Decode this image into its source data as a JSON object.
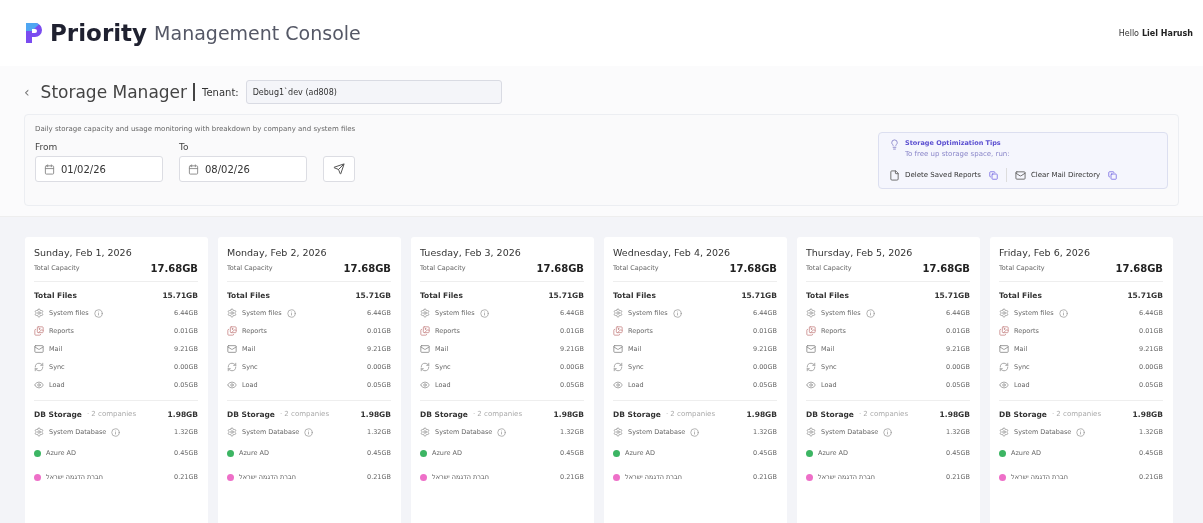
{
  "header": {
    "brand": "Priority",
    "app_title": "Management Console",
    "greeting": "Hello",
    "user": "Liel Harush"
  },
  "page": {
    "back": "‹",
    "title": "Storage Manager",
    "tenant_label": "Tenant:",
    "tenant_value": "Debug1`dev (ad808)"
  },
  "filters": {
    "description": "Daily storage capacity and usage monitoring with breakdown by company and system files",
    "from_label": "From",
    "from_value": "01/02/26",
    "to_label": "To",
    "to_value": "08/02/26"
  },
  "tips": {
    "title": "Storage Optimization Tips",
    "subtitle": "To free up storage space, run:",
    "actions": [
      {
        "kind": "reports",
        "label": "Delete Saved Reports"
      },
      {
        "kind": "mail",
        "label": "Clear Mail Directory"
      }
    ]
  },
  "days": [
    {
      "date": "Sunday, Feb 1, 2026",
      "capacity_label": "Total Capacity",
      "capacity": "17.68GB",
      "files_label": "Total Files",
      "files_total": "15.71GB",
      "files": [
        {
          "kind": "system",
          "label": "System files",
          "value": "6.44GB"
        },
        {
          "kind": "reports",
          "label": "Reports",
          "value": "0.01GB"
        },
        {
          "kind": "mail",
          "label": "Mail",
          "value": "9.21GB"
        },
        {
          "kind": "sync",
          "label": "Sync",
          "value": "0.00GB"
        },
        {
          "kind": "load",
          "label": "Load",
          "value": "0.05GB"
        }
      ],
      "db_label": "DB Storage",
      "db_note": "· 2 companies",
      "db_total": "1.98GB",
      "db": [
        {
          "kind": "system",
          "label": "System Database",
          "value": "1.32GB"
        },
        {
          "kind": "company",
          "color": "#3cb563",
          "label": "Azure AD",
          "value": "0.45GB"
        },
        {
          "kind": "company",
          "color": "#ee6fc8",
          "label": "חברת הדגמה ישראל",
          "value": "0.21GB"
        }
      ]
    },
    {
      "date": "Monday, Feb 2, 2026",
      "capacity_label": "Total Capacity",
      "capacity": "17.68GB",
      "files_label": "Total Files",
      "files_total": "15.71GB",
      "files": [
        {
          "kind": "system",
          "label": "System files",
          "value": "6.44GB"
        },
        {
          "kind": "reports",
          "label": "Reports",
          "value": "0.01GB"
        },
        {
          "kind": "mail",
          "label": "Mail",
          "value": "9.21GB"
        },
        {
          "kind": "sync",
          "label": "Sync",
          "value": "0.00GB"
        },
        {
          "kind": "load",
          "label": "Load",
          "value": "0.05GB"
        }
      ],
      "db_label": "DB Storage",
      "db_note": "· 2 companies",
      "db_total": "1.98GB",
      "db": [
        {
          "kind": "system",
          "label": "System Database",
          "value": "1.32GB"
        },
        {
          "kind": "company",
          "color": "#3cb563",
          "label": "Azure AD",
          "value": "0.45GB"
        },
        {
          "kind": "company",
          "color": "#ee6fc8",
          "label": "חברת הדגמה ישראל",
          "value": "0.21GB"
        }
      ]
    },
    {
      "date": "Tuesday, Feb 3, 2026",
      "capacity_label": "Total Capacity",
      "capacity": "17.68GB",
      "files_label": "Total Files",
      "files_total": "15.71GB",
      "files": [
        {
          "kind": "system",
          "label": "System files",
          "value": "6.44GB"
        },
        {
          "kind": "reports",
          "label": "Reports",
          "value": "0.01GB"
        },
        {
          "kind": "mail",
          "label": "Mail",
          "value": "9.21GB"
        },
        {
          "kind": "sync",
          "label": "Sync",
          "value": "0.00GB"
        },
        {
          "kind": "load",
          "label": "Load",
          "value": "0.05GB"
        }
      ],
      "db_label": "DB Storage",
      "db_note": "· 2 companies",
      "db_total": "1.98GB",
      "db": [
        {
          "kind": "system",
          "label": "System Database",
          "value": "1.32GB"
        },
        {
          "kind": "company",
          "color": "#3cb563",
          "label": "Azure AD",
          "value": "0.45GB"
        },
        {
          "kind": "company",
          "color": "#ee6fc8",
          "label": "חברת הדגמה ישראל",
          "value": "0.21GB"
        }
      ]
    },
    {
      "date": "Wednesday, Feb 4, 2026",
      "capacity_label": "Total Capacity",
      "capacity": "17.68GB",
      "files_label": "Total Files",
      "files_total": "15.71GB",
      "files": [
        {
          "kind": "system",
          "label": "System files",
          "value": "6.44GB"
        },
        {
          "kind": "reports",
          "label": "Reports",
          "value": "0.01GB"
        },
        {
          "kind": "mail",
          "label": "Mail",
          "value": "9.21GB"
        },
        {
          "kind": "sync",
          "label": "Sync",
          "value": "0.00GB"
        },
        {
          "kind": "load",
          "label": "Load",
          "value": "0.05GB"
        }
      ],
      "db_label": "DB Storage",
      "db_note": "· 2 companies",
      "db_total": "1.98GB",
      "db": [
        {
          "kind": "system",
          "label": "System Database",
          "value": "1.32GB"
        },
        {
          "kind": "company",
          "color": "#3cb563",
          "label": "Azure AD",
          "value": "0.45GB"
        },
        {
          "kind": "company",
          "color": "#ee6fc8",
          "label": "חברת הדגמה ישראל",
          "value": "0.21GB"
        }
      ]
    },
    {
      "date": "Thursday, Feb 5, 2026",
      "capacity_label": "Total Capacity",
      "capacity": "17.68GB",
      "files_label": "Total Files",
      "files_total": "15.71GB",
      "files": [
        {
          "kind": "system",
          "label": "System files",
          "value": "6.44GB"
        },
        {
          "kind": "reports",
          "label": "Reports",
          "value": "0.01GB"
        },
        {
          "kind": "mail",
          "label": "Mail",
          "value": "9.21GB"
        },
        {
          "kind": "sync",
          "label": "Sync",
          "value": "0.00GB"
        },
        {
          "kind": "load",
          "label": "Load",
          "value": "0.05GB"
        }
      ],
      "db_label": "DB Storage",
      "db_note": "· 2 companies",
      "db_total": "1.98GB",
      "db": [
        {
          "kind": "system",
          "label": "System Database",
          "value": "1.32GB"
        },
        {
          "kind": "company",
          "color": "#3cb563",
          "label": "Azure AD",
          "value": "0.45GB"
        },
        {
          "kind": "company",
          "color": "#ee6fc8",
          "label": "חברת הדגמה ישראל",
          "value": "0.21GB"
        }
      ]
    },
    {
      "date": "Friday, Feb 6, 2026",
      "capacity_label": "Total Capacity",
      "capacity": "17.68GB",
      "files_label": "Total Files",
      "files_total": "15.71GB",
      "files": [
        {
          "kind": "system",
          "label": "System files",
          "value": "6.44GB"
        },
        {
          "kind": "reports",
          "label": "Reports",
          "value": "0.01GB"
        },
        {
          "kind": "mail",
          "label": "Mail",
          "value": "9.21GB"
        },
        {
          "kind": "sync",
          "label": "Sync",
          "value": "0.00GB"
        },
        {
          "kind": "load",
          "label": "Load",
          "value": "0.05GB"
        }
      ],
      "db_label": "DB Storage",
      "db_note": "· 2 companies",
      "db_total": "1.98GB",
      "db": [
        {
          "kind": "system",
          "label": "System Database",
          "value": "1.32GB"
        },
        {
          "kind": "company",
          "color": "#3cb563",
          "label": "Azure AD",
          "value": "0.45GB"
        },
        {
          "kind": "company",
          "color": "#ee6fc8",
          "label": "חברת הדגמה ישראל",
          "value": "0.21GB"
        }
      ]
    }
  ]
}
